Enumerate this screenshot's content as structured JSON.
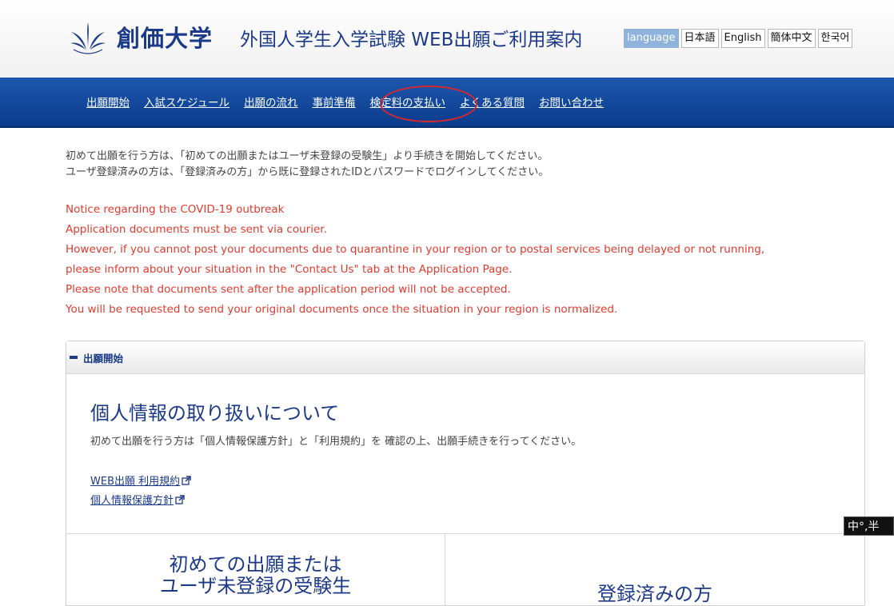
{
  "header": {
    "brand": "創価大学",
    "title": "外国人学生入学試験 WEB出願ご利用案内",
    "language_label": "language",
    "languages": [
      "日本語",
      "English",
      "簡体中文",
      "한국어"
    ]
  },
  "nav": {
    "items": [
      "出願開始",
      "入試スケジュール",
      "出願の流れ",
      "事前準備",
      "検定料の支払い",
      "よくある質問",
      "お問い合わせ"
    ]
  },
  "intro": {
    "line1": "初めて出願を行う方は、「初めての出願またはユーザ未登録の受験生」より手続きを開始してください。",
    "line2": "ユーザ登録済みの方は、「登録済みの方」から既に登録されたIDとパスワードでログインしてください。"
  },
  "notice": {
    "lines": [
      "Notice regarding the COVID-19 outbreak",
      "Application documents must be sent via courier.",
      "However, if you cannot post your documents due to quarantine in your region or to postal services being delayed or not running,",
      "please inform about your situation in the \"Contact Us\" tab at the Application Page.",
      "Please note that documents sent after the application period will not be accepted.",
      "You will be requested to send your original documents once the situation in your region is normalized."
    ]
  },
  "panel": {
    "heading": "出願開始",
    "privacy_title": "個人情報の取り扱いについて",
    "privacy_desc": "初めて出願を行う方は「個人情報保護方針」と「利用規約」を 確認の上、出願手続きを行ってください。",
    "links": [
      "WEB出願 利用規約",
      "個人情報保護方針"
    ],
    "first_time_line1": "初めての出願または",
    "first_time_line2": "ユーザ未登録の受験生",
    "registered": "登録済みの方"
  },
  "ime": {
    "text": "中°,半"
  },
  "colors": {
    "brand": "#1b3a8a",
    "nav": "#0b3c8c",
    "notice": "#e03b2e",
    "highlight": "#d9272e"
  }
}
